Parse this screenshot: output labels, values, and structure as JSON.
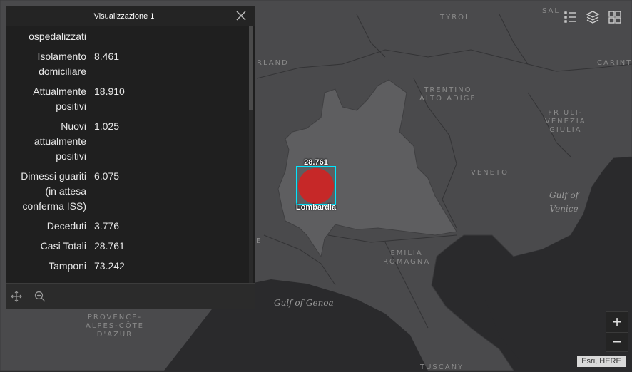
{
  "popup": {
    "title": "Visualizzazione 1",
    "fields": [
      {
        "label": [
          "ospedalizzati"
        ],
        "value": ""
      },
      {
        "label": [
          "Isolamento",
          "domiciliare"
        ],
        "value": "8.461"
      },
      {
        "label": [
          "Attualmente",
          "positivi"
        ],
        "value": "18.910"
      },
      {
        "label": [
          "Nuovi",
          "attualmente",
          "positivi"
        ],
        "value": "1.025"
      },
      {
        "label": [
          "Dimessi guariti",
          "(in attesa",
          "conferma ISS)"
        ],
        "value": "6.075"
      },
      {
        "label": [
          "Deceduti"
        ],
        "value": "3.776"
      },
      {
        "label": [
          "Casi Totali"
        ],
        "value": "28.761"
      },
      {
        "label": [
          "Tamponi"
        ],
        "value": "73.242"
      }
    ]
  },
  "map": {
    "labels": {
      "tyrol": "TYROL",
      "trentino": [
        "TRENTINO",
        "ALTO ADIGE"
      ],
      "friuli": [
        "FRIULI-",
        "VENEZIA",
        "GIULIA"
      ],
      "veneto": "VENETO",
      "emilia": [
        "EMILIA",
        "ROMAGNA"
      ],
      "provence": [
        "PROVENCE-",
        "ALPES-CÔTE",
        "D'AZUR"
      ],
      "tuscany": "TUSCANY",
      "gulf_venice": [
        "Gulf of",
        "Venice"
      ],
      "gulf_genoa": "Gulf of Genoa",
      "rland": "RLAND",
      "carint": "CARINT",
      "salz": "SAL",
      "edge_e": "E"
    },
    "symbol": {
      "region": "Lombardia",
      "value": "28.761",
      "fill_color": "#c62828",
      "highlight_color": "#00e5ff"
    }
  },
  "icons": {
    "legend": "legend-icon",
    "layers": "layers-icon",
    "basemap": "basemap-gallery-icon",
    "pan": "pan-to-icon",
    "zoomto": "zoom-to-icon",
    "close": "close-icon"
  },
  "zoom": {
    "in": "+",
    "out": "−"
  },
  "attribution": "Esri, HERE",
  "colors": {
    "land": "#4a4a4c",
    "lombardia": "#5e5e60",
    "sea": "#2a2a2c",
    "popup_bg": "#1f1f1f"
  }
}
